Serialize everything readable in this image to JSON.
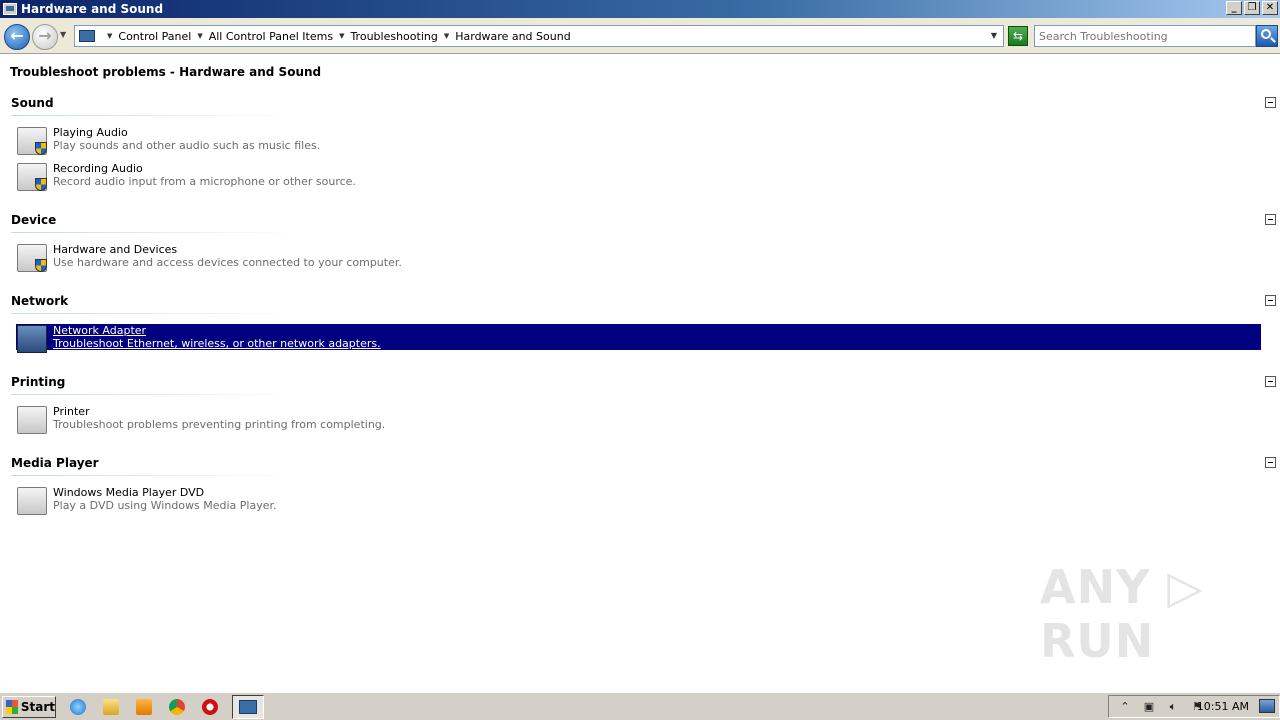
{
  "window": {
    "title": "Hardware and Sound"
  },
  "address": {
    "crumbs": [
      "Control Panel",
      "All Control Panel Items",
      "Troubleshooting",
      "Hardware and Sound"
    ]
  },
  "search": {
    "placeholder": "Search Troubleshooting"
  },
  "page": {
    "title": "Troubleshoot problems - Hardware and Sound"
  },
  "groups": [
    {
      "header": "Sound",
      "items": [
        {
          "name": "Playing Audio",
          "desc": "Play sounds and other audio such as music files."
        },
        {
          "name": "Recording Audio",
          "desc": "Record audio input from a microphone or other source."
        }
      ]
    },
    {
      "header": "Device",
      "items": [
        {
          "name": "Hardware and Devices",
          "desc": "Use hardware and access devices connected to your computer."
        }
      ]
    },
    {
      "header": "Network",
      "items": [
        {
          "name": "Network Adapter",
          "desc": "Troubleshoot Ethernet, wireless, or other network adapters."
        }
      ]
    },
    {
      "header": "Printing",
      "items": [
        {
          "name": "Printer",
          "desc": "Troubleshoot problems preventing printing from completing."
        }
      ]
    },
    {
      "header": "Media Player",
      "items": [
        {
          "name": "Windows Media Player DVD",
          "desc": "Play a DVD using Windows Media Player."
        }
      ]
    }
  ],
  "watermark": {
    "text": "ANY ▷ RUN"
  },
  "taskbar": {
    "start_label": "Start",
    "clock": "10:51 AM"
  },
  "colors": {
    "selection": "#000080",
    "titlebar": "#0a246a"
  }
}
